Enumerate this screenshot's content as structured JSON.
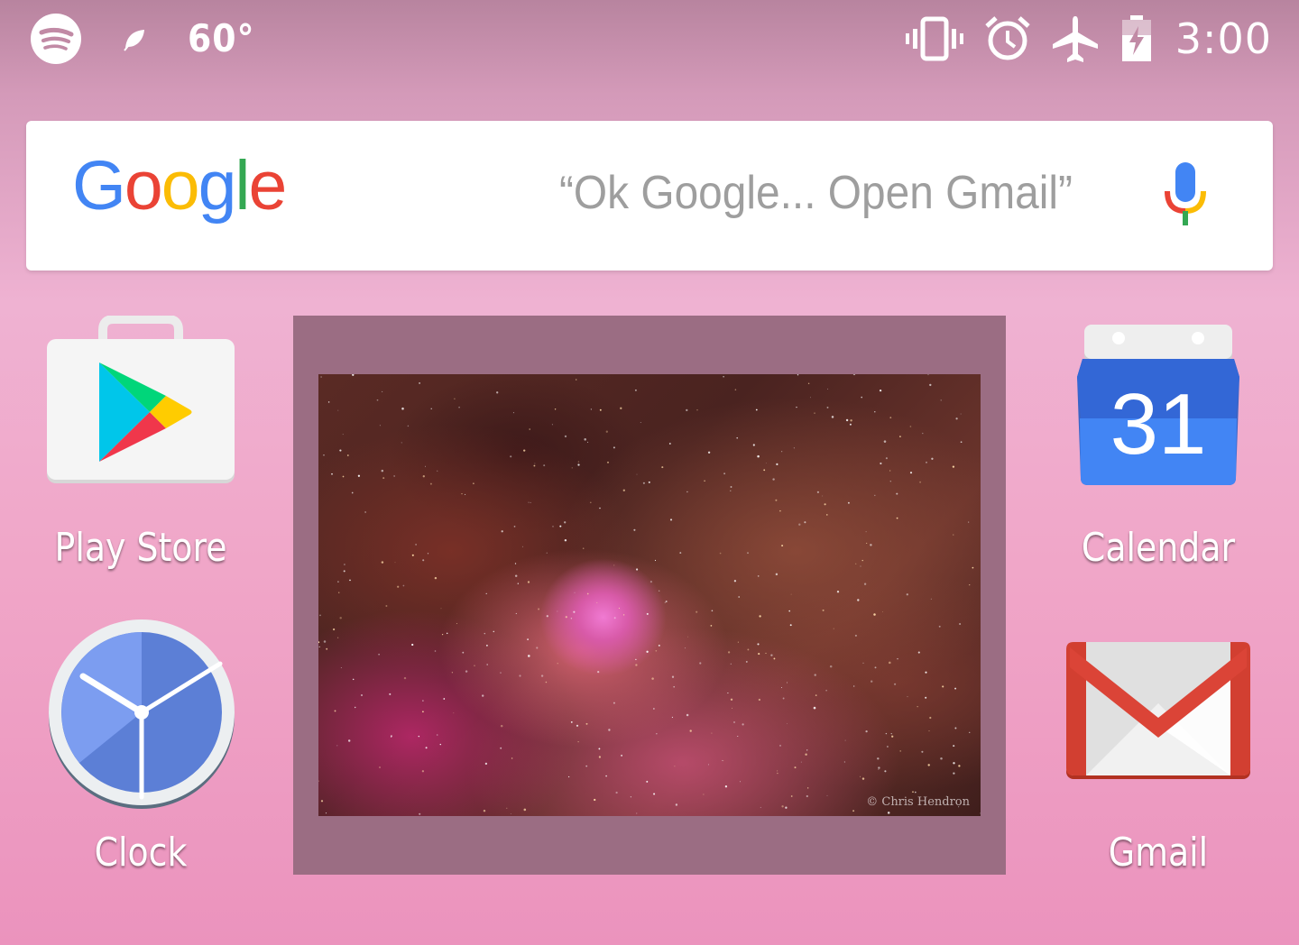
{
  "status_bar": {
    "left_icons": [
      "spotify-icon",
      "leaf-icon"
    ],
    "temperature": "60°",
    "right_icons": [
      "vibrate-icon",
      "alarm-icon",
      "airplane-mode-icon",
      "battery-charging-icon"
    ],
    "time": "3:00"
  },
  "search": {
    "logo_letters": [
      {
        "char": "G",
        "color": "#4285F4"
      },
      {
        "char": "o",
        "color": "#EA4335"
      },
      {
        "char": "o",
        "color": "#FBBC05"
      },
      {
        "char": "g",
        "color": "#4285F4"
      },
      {
        "char": "l",
        "color": "#34A853"
      },
      {
        "char": "e",
        "color": "#EA4335"
      }
    ],
    "hint": "“Ok Google... Open Gmail”",
    "mic_icon": "microphone-icon"
  },
  "apps": {
    "play_store": {
      "label": "Play Store",
      "icon": "play-store-icon"
    },
    "calendar": {
      "label": "Calendar",
      "icon": "calendar-icon",
      "date": "31"
    },
    "clock": {
      "label": "Clock",
      "icon": "clock-icon"
    },
    "gmail": {
      "label": "Gmail",
      "icon": "gmail-icon"
    }
  },
  "photo_widget": {
    "credit": "© Chris Hendron"
  },
  "colors": {
    "google_blue": "#4285F4",
    "google_red": "#EA4335",
    "google_yellow": "#FBBC05",
    "google_green": "#34A853",
    "widget_frame": "#9b6d83"
  }
}
